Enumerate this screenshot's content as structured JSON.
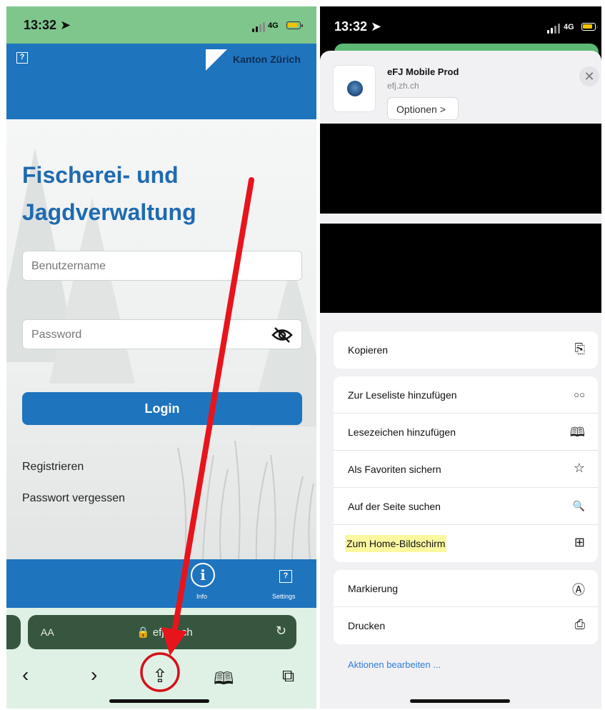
{
  "left_screen": {
    "status": {
      "time": "13:32 ➤",
      "network": "4G"
    },
    "header": {
      "help_icon": "?",
      "kanton_label": "Kanton Zürich"
    },
    "login": {
      "title_line1": "Fischerei- und",
      "title_line2": "Jagdverwaltung",
      "username_placeholder": "Benutzername",
      "password_placeholder": "Password",
      "login_label": "Login",
      "register_link": "Registrieren",
      "forgot_link": "Passwort vergessen"
    },
    "footer": {
      "info_glyph": "i",
      "info_label": "Info",
      "settings_glyph": "?",
      "settings_label": "Settings"
    },
    "browser": {
      "aa_label": "AA",
      "url": "🔒 efj.zh.ch",
      "reload_glyph": "↻",
      "back_glyph": "‹",
      "forward_glyph": "›",
      "share_glyph": "⇪",
      "bookmarks_glyph": "🕮",
      "tabs_glyph": "⧉"
    }
  },
  "right_screen": {
    "status": {
      "time": "13:32 ➤",
      "network": "4G"
    },
    "share_sheet": {
      "app_name": "eFJ Mobile Prod",
      "app_url": "efj.zh.ch",
      "options_label": "Optionen >",
      "close_glyph": "✕",
      "groups": [
        [
          {
            "label": "Kopieren",
            "icon": "⎘"
          }
        ],
        [
          {
            "label": "Zur Leseliste hinzufügen",
            "icon": "○○"
          },
          {
            "label": "Lesezeichen hinzufügen",
            "icon": "🕮"
          },
          {
            "label": "Als Favoriten sichern",
            "icon": "☆"
          },
          {
            "label": "Auf der Seite suchen",
            "icon": "🔍"
          },
          {
            "label": "Zum Home-Bildschirm",
            "icon": "⊞",
            "highlighted": true
          }
        ],
        [
          {
            "label": "Markierung",
            "icon": "Ⓐ"
          },
          {
            "label": "Drucken",
            "icon": "⎙"
          }
        ]
      ],
      "edit_actions": "Aktionen bearbeiten ..."
    }
  },
  "colors": {
    "zh_blue": "#1f74be",
    "status_green": "#7ec68b",
    "toolbar_green": "#dff1e4",
    "arrow_red": "#e8141c",
    "highlight_yellow": "#fbf8a0",
    "link_blue": "#2f7bd8"
  }
}
